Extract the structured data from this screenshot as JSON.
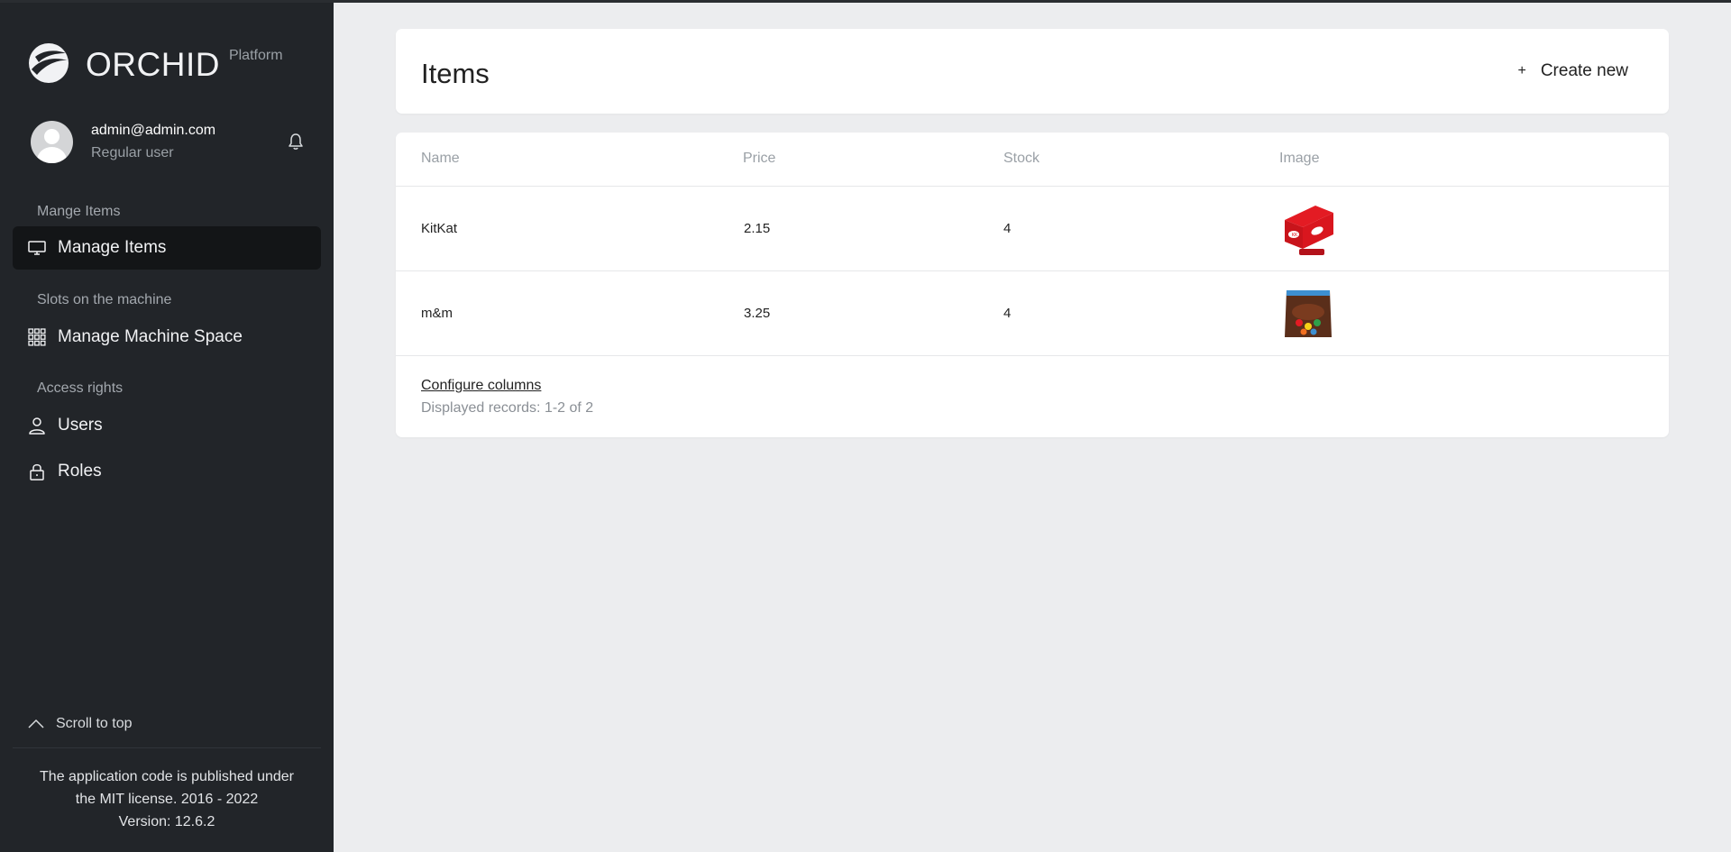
{
  "brand": {
    "name": "ORCHID",
    "sub": "Platform"
  },
  "profile": {
    "email": "admin@admin.com",
    "role": "Regular user"
  },
  "nav": {
    "section1": "Mange Items",
    "item1": "Manage Items",
    "section2": "Slots on the machine",
    "item2": "Manage Machine Space",
    "section3": "Access rights",
    "item3": "Users",
    "item4": "Roles"
  },
  "sidebar_footer": {
    "scroll_top": "Scroll to top",
    "line1": "The application code is published under",
    "line2": "the MIT license. 2016 - 2022",
    "version": "Version: 12.6.2"
  },
  "page": {
    "title": "Items",
    "create_label": "Create new"
  },
  "table": {
    "headers": {
      "name": "Name",
      "price": "Price",
      "stock": "Stock",
      "image": "Image"
    },
    "rows": [
      {
        "name": "KitKat",
        "price": "2.15",
        "stock": "4",
        "image": "kitkat-box"
      },
      {
        "name": "m&m",
        "price": "3.25",
        "stock": "4",
        "image": "mm-bag"
      }
    ],
    "configure": "Configure columns",
    "records": "Displayed records: 1-2 of 2"
  },
  "colors": {
    "sidebar": "#222529",
    "active_item": "#131517",
    "background": "#ecedef",
    "card": "#ffffff"
  }
}
